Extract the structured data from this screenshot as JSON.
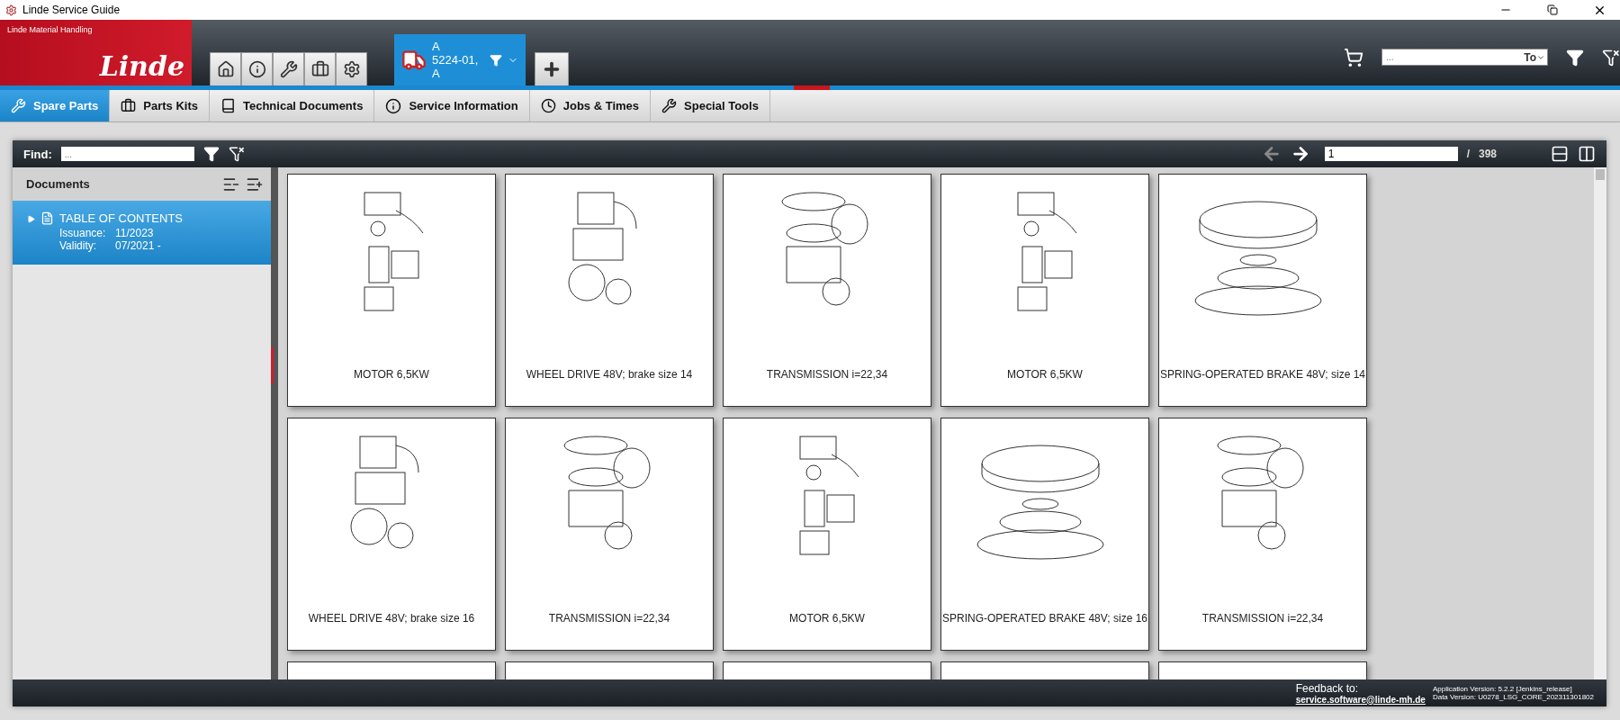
{
  "window": {
    "title": "Linde Service Guide"
  },
  "logo": {
    "tagline": "Linde Material Handling",
    "wordmark": "Linde"
  },
  "vehicle_tab": {
    "line1": "A",
    "line2": "5224-01, A",
    "selected": true
  },
  "header_search": {
    "placeholder": "...",
    "mode": "To"
  },
  "tabs": [
    {
      "label": "Spare Parts",
      "selected": true
    },
    {
      "label": "Parts Kits",
      "selected": false
    },
    {
      "label": "Technical Documents",
      "selected": false
    },
    {
      "label": "Service Information",
      "selected": false
    },
    {
      "label": "Jobs & Times",
      "selected": false
    },
    {
      "label": "Special Tools",
      "selected": false
    }
  ],
  "find": {
    "label": "Find:",
    "placeholder": "..."
  },
  "pager": {
    "page": "1",
    "separator": "/",
    "total": "398",
    "prev_disabled": true
  },
  "sidebar": {
    "title": "Documents",
    "items": [
      {
        "title": "TABLE OF CONTENTS",
        "expanded": false,
        "selected": true,
        "issuance_label": "Issuance:",
        "issuance": "11/2023",
        "validity_label": "Validity:",
        "validity": "07/2021 -"
      }
    ]
  },
  "cards": [
    {
      "kind": "motor",
      "title": "MOTOR 6,5KW"
    },
    {
      "kind": "wheel",
      "title": "WHEEL DRIVE 48V; brake size 14"
    },
    {
      "kind": "transmission",
      "title": "TRANSMISSION i=22,34"
    },
    {
      "kind": "motor",
      "title": "MOTOR 6,5KW"
    },
    {
      "kind": "brake",
      "title": "SPRING-OPERATED BRAKE 48V; size 14"
    },
    {
      "kind": "wheel",
      "title": "WHEEL DRIVE 48V; brake size 16"
    },
    {
      "kind": "transmission",
      "title": "TRANSMISSION i=22,34"
    },
    {
      "kind": "motor",
      "title": "MOTOR 6,5KW"
    },
    {
      "kind": "brake",
      "title": "SPRING-OPERATED BRAKE 48V; size 16"
    },
    {
      "kind": "transmission",
      "title": "TRANSMISSION i=22,34"
    },
    {
      "kind": "partial"
    },
    {
      "kind": "partial"
    },
    {
      "kind": "partial"
    },
    {
      "kind": "partial"
    },
    {
      "kind": "partial"
    }
  ],
  "footer": {
    "feedback_label": "Feedback to:",
    "feedback_email": "service.software@linde-mh.de",
    "app_version": "Application Version: 5.2.2 [Jenkins_release]",
    "data_version": "Data Version: U0278_LSG_CORE_202311301802"
  }
}
